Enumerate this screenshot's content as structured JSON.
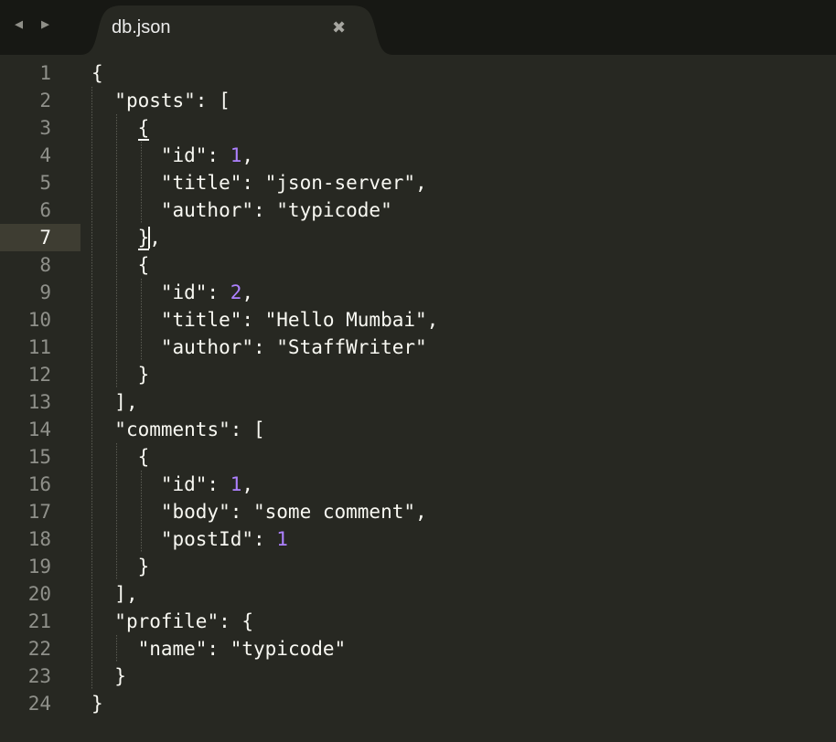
{
  "navigation": {
    "back": "◀",
    "forward": "▶"
  },
  "tab": {
    "title": "db.json",
    "close": "✖"
  },
  "editor": {
    "active_line": 7,
    "lines": [
      {
        "number": "1",
        "indent": "",
        "segments": [
          {
            "text": "{"
          }
        ]
      },
      {
        "number": "2",
        "indent": "  ",
        "segments": [
          {
            "text": "\"posts\": ["
          }
        ]
      },
      {
        "number": "3",
        "indent": "    ",
        "segments": [
          {
            "text": "{",
            "match": true
          }
        ]
      },
      {
        "number": "4",
        "indent": "      ",
        "segments": [
          {
            "text": "\"id\": "
          },
          {
            "text": "1",
            "num": true
          },
          {
            "text": ","
          }
        ]
      },
      {
        "number": "5",
        "indent": "      ",
        "segments": [
          {
            "text": "\"title\": \"json-server\","
          }
        ]
      },
      {
        "number": "6",
        "indent": "      ",
        "segments": [
          {
            "text": "\"author\": \"typicode\""
          }
        ]
      },
      {
        "number": "7",
        "indent": "    ",
        "segments": [
          {
            "text": "}",
            "match": true
          },
          {
            "cursor": true
          },
          {
            "text": ","
          }
        ]
      },
      {
        "number": "8",
        "indent": "    ",
        "segments": [
          {
            "text": "{"
          }
        ]
      },
      {
        "number": "9",
        "indent": "      ",
        "segments": [
          {
            "text": "\"id\": "
          },
          {
            "text": "2",
            "num": true
          },
          {
            "text": ","
          }
        ]
      },
      {
        "number": "10",
        "indent": "      ",
        "segments": [
          {
            "text": "\"title\": \"Hello Mumbai\","
          }
        ]
      },
      {
        "number": "11",
        "indent": "      ",
        "segments": [
          {
            "text": "\"author\": \"StaffWriter\""
          }
        ]
      },
      {
        "number": "12",
        "indent": "    ",
        "segments": [
          {
            "text": "}"
          }
        ]
      },
      {
        "number": "13",
        "indent": "  ",
        "segments": [
          {
            "text": "],"
          }
        ]
      },
      {
        "number": "14",
        "indent": "  ",
        "segments": [
          {
            "text": "\"comments\": ["
          }
        ]
      },
      {
        "number": "15",
        "indent": "    ",
        "segments": [
          {
            "text": "{"
          }
        ]
      },
      {
        "number": "16",
        "indent": "      ",
        "segments": [
          {
            "text": "\"id\": "
          },
          {
            "text": "1",
            "num": true
          },
          {
            "text": ","
          }
        ]
      },
      {
        "number": "17",
        "indent": "      ",
        "segments": [
          {
            "text": "\"body\": \"some comment\","
          }
        ]
      },
      {
        "number": "18",
        "indent": "      ",
        "segments": [
          {
            "text": "\"postId\": "
          },
          {
            "text": "1",
            "num": true
          }
        ]
      },
      {
        "number": "19",
        "indent": "    ",
        "segments": [
          {
            "text": "}"
          }
        ]
      },
      {
        "number": "20",
        "indent": "  ",
        "segments": [
          {
            "text": "],"
          }
        ]
      },
      {
        "number": "21",
        "indent": "  ",
        "segments": [
          {
            "text": "\"profile\": {"
          }
        ]
      },
      {
        "number": "22",
        "indent": "    ",
        "segments": [
          {
            "text": "\"name\": \"typicode\""
          }
        ]
      },
      {
        "number": "23",
        "indent": "  ",
        "segments": [
          {
            "text": "}"
          }
        ]
      },
      {
        "number": "24",
        "indent": "",
        "segments": [
          {
            "text": "}"
          }
        ]
      }
    ]
  },
  "colors": {
    "background": "#272822",
    "tabbar": "#171814",
    "text": "#f8f8f2",
    "number": "#ae81ff",
    "gutter_text": "#8f908a",
    "active_line": "#3e3d32"
  }
}
